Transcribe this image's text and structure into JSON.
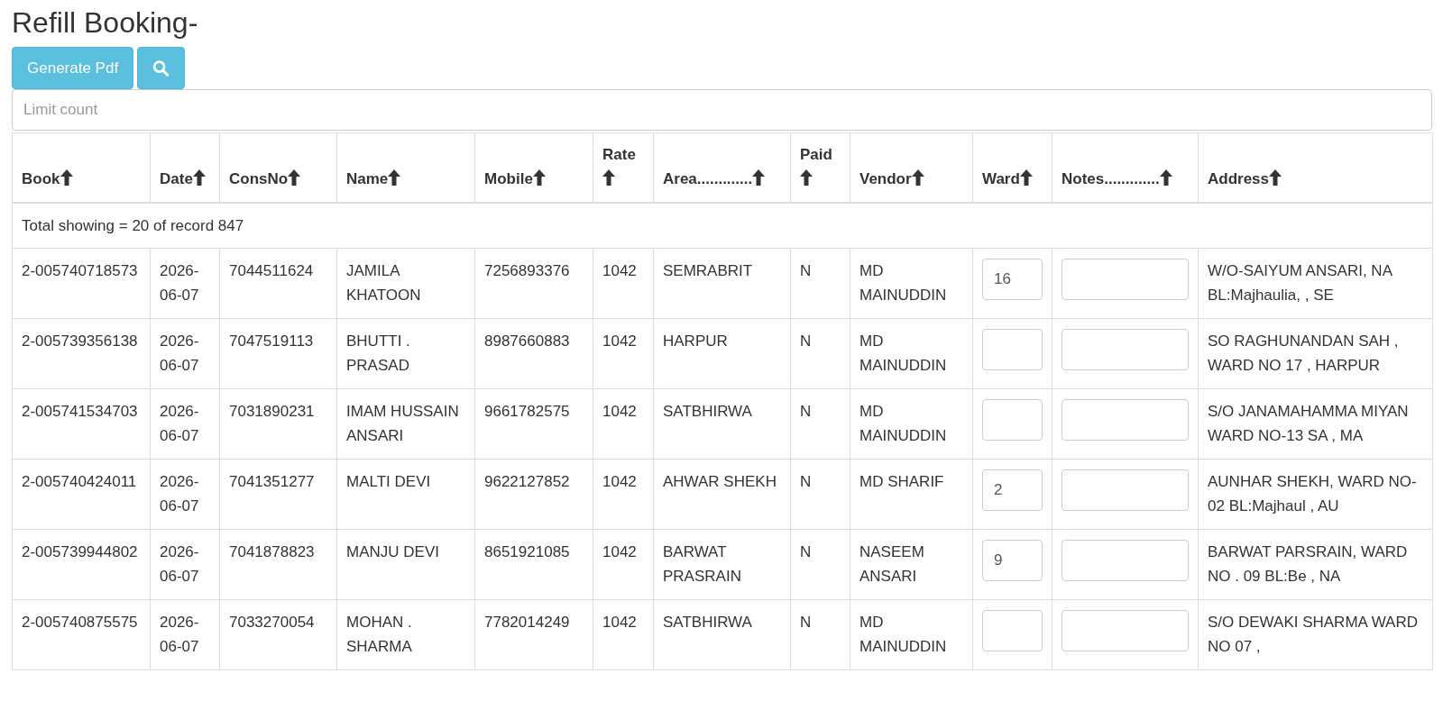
{
  "title": "Refill Booking-",
  "toolbar": {
    "generate_button": "Generate Pdf",
    "limit_field": {
      "placeholder": "Limit count"
    }
  },
  "table": {
    "columns": [
      "Book",
      "Date",
      "ConsNo",
      "Name",
      "Mobile",
      "Rate",
      "Area.............",
      "Paid",
      "Vendor",
      "Ward",
      "Notes.............",
      "Address"
    ],
    "summary": "Total showing = 20 of record 847",
    "rows": [
      {
        "book": "2-005740718573",
        "date": "2026-06-07",
        "cons_no": "7044511624",
        "name": "JAMILA KHATOON",
        "mobile": "7256893376",
        "rate": "1042",
        "area": "SEMRABRIT",
        "paid": "N",
        "vendor": "MD MAINUDDIN",
        "ward": "16",
        "address": "W/O-SAIYUM ANSARI, NA BL:Majhaulia, , SE"
      },
      {
        "book": "2-005739356138",
        "date": "2026-06-07",
        "cons_no": "7047519113",
        "name": "BHUTTI . PRASAD",
        "mobile": "8987660883",
        "rate": "1042",
        "area": "HARPUR",
        "paid": "N",
        "vendor": "MD MAINUDDIN",
        "address": "SO RAGHUNANDAN SAH , WARD NO 17 , HARPUR"
      },
      {
        "book": "2-005741534703",
        "date": "2026-06-07",
        "cons_no": "7031890231",
        "name": "IMAM HUSSAIN ANSARI",
        "mobile": "9661782575",
        "rate": "1042",
        "area": "SATBHIRWA",
        "paid": "N",
        "vendor": "MD MAINUDDIN",
        "address": "S/O JANAMAHAMMA MIYAN WARD NO-13 SA , MA"
      },
      {
        "book": "2-005740424011",
        "date": "2026-06-07",
        "cons_no": "7041351277",
        "name": "MALTI DEVI",
        "mobile": "9622127852",
        "rate": "1042",
        "area": "AHWAR SHEKH",
        "paid": "N",
        "vendor": "MD SHARIF",
        "ward": "2",
        "address": "AUNHAR SHEKH, WARD NO-02 BL:Majhaul , AU"
      },
      {
        "book": "2-005739944802",
        "date": "2026-06-07",
        "cons_no": "7041878823",
        "name": "MANJU DEVI",
        "mobile": "8651921085",
        "rate": "1042",
        "area": "BARWAT PRASRAIN",
        "paid": "N",
        "vendor": "NASEEM ANSARI",
        "ward": "9",
        "address": "BARWAT PARSRAIN, WARD NO . 09 BL:Be , NA"
      },
      {
        "book": "2-005740875575",
        "date": "2026-06-07",
        "cons_no": "7033270054",
        "name": "MOHAN . SHARMA",
        "mobile": "7782014249",
        "rate": "1042",
        "area": "SATBHIRWA",
        "paid": "N",
        "vendor": "MD MAINUDDIN",
        "address": "S/O DEWAKI SHARMA WARD NO 07 ,"
      }
    ]
  }
}
